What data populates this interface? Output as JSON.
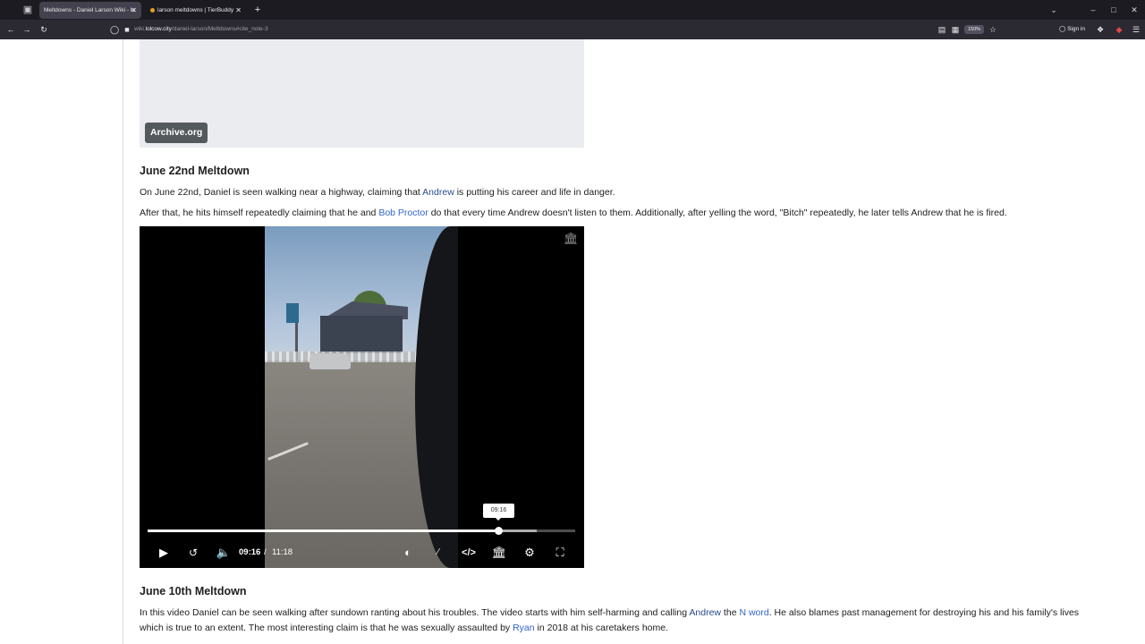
{
  "browser": {
    "tabs": [
      {
        "title": "Meltdowns - Daniel Larson Wiki - lo",
        "active": true
      },
      {
        "title": "larson meltdowns | TierBuddy",
        "active": false
      }
    ],
    "url_prefix": "wiki.",
    "url_domain": "lolcow.city",
    "url_path": "/daniel-larson/Meltdowns#cite_note-3",
    "zoom": "150%",
    "signin_label": "Sign in",
    "icons": {
      "tab_overview": "tab-overview-icon",
      "new_tab": "plus-icon",
      "back": "arrow-left-icon",
      "forward": "arrow-right-icon",
      "reload": "reload-icon"
    }
  },
  "embed": {
    "badge": "Archive.org"
  },
  "sections": [
    {
      "heading": "June 22nd Meltdown",
      "p1": {
        "pre": "On June 22nd, Daniel is seen walking near a highway, claiming that ",
        "link": "Andrew",
        "post": " is putting his career and life in danger."
      },
      "p2": {
        "pre": "After that, he hits himself repeatedly claiming that he and ",
        "link": "Bob Proctor",
        "post": " do that every time Andrew doesn't listen to them. Additionally, after yelling the word, \"Bitch\" repeatedly, he later tells Andrew that he is fired."
      }
    },
    {
      "heading": "June 10th Meltdown",
      "p1": {
        "pre": "In this video Daniel can be seen walking after sundown ranting about his troubles. The video starts with him self-harming and calling ",
        "link1": "Andrew",
        "mid": " the ",
        "link2": "N word",
        "post": ". He also blames past management for destroying his and his family's lives"
      },
      "p2": {
        "pre": "which is true to an extent. The most interesting claim is that he was sexually assaulted by ",
        "link": "Ryan",
        "post": " in 2018 at his caretakers home."
      }
    }
  ],
  "video": {
    "current_time": "09:16",
    "separator": "/",
    "duration": "11:18",
    "tooltip_time": "09:16",
    "progress_fraction": 0.82,
    "buffered_fraction": 0.91
  }
}
